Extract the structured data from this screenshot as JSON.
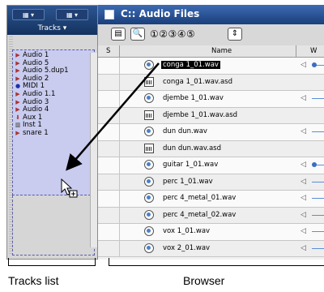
{
  "left_panel": {
    "toolbar_buttons": [
      "▾",
      "▾"
    ],
    "header_label": "Tracks",
    "tracks": [
      {
        "name": "Audio 1",
        "icon": "audio-track-icon",
        "color": "#a33"
      },
      {
        "name": "Audio 5",
        "icon": "audio-track-icon",
        "color": "#a33"
      },
      {
        "name": "Audio 5.dup1",
        "icon": "audio-track-icon",
        "color": "#a33"
      },
      {
        "name": "Audio 2",
        "icon": "audio-track-icon",
        "color": "#a33"
      },
      {
        "name": "MIDI 1",
        "icon": "midi-track-icon",
        "color": "#1d2fa8"
      },
      {
        "name": "Audio 1.1",
        "icon": "audio-track-icon",
        "color": "#a33"
      },
      {
        "name": "Audio 3",
        "icon": "audio-track-icon",
        "color": "#a33"
      },
      {
        "name": "Audio 4",
        "icon": "audio-track-icon",
        "color": "#a33"
      },
      {
        "name": "Aux 1",
        "icon": "aux-track-icon",
        "color": "#a33"
      },
      {
        "name": "Inst 1",
        "icon": "instrument-track-icon",
        "color": "#333"
      },
      {
        "name": "snare 1",
        "icon": "audio-track-icon",
        "color": "#a33"
      }
    ]
  },
  "browser": {
    "title": "C:: Audio Files",
    "toolbar": {
      "view_numbers": "①②③④⑤"
    },
    "columns": {
      "s": "S",
      "name": "Name",
      "waveform": "W"
    },
    "files": [
      {
        "name": "conga 1_01.wav",
        "type": "wav",
        "selected": true
      },
      {
        "name": "conga 1_01.wav.asd",
        "type": "asd",
        "selected": false
      },
      {
        "name": "djembe 1_01.wav",
        "type": "wav",
        "selected": false
      },
      {
        "name": "djembe 1_01.wav.asd",
        "type": "asd",
        "selected": false
      },
      {
        "name": "dun dun.wav",
        "type": "wav",
        "selected": false
      },
      {
        "name": "dun dun.wav.asd",
        "type": "asd",
        "selected": false
      },
      {
        "name": "guitar 1_01.wav",
        "type": "wav",
        "selected": false
      },
      {
        "name": "perc 1_01.wav",
        "type": "wav",
        "selected": false
      },
      {
        "name": "perc 4_metal_01.wav",
        "type": "wav",
        "selected": false
      },
      {
        "name": "perc 4_metal_02.wav",
        "type": "wav",
        "selected": false
      },
      {
        "name": "vox 1_01.wav",
        "type": "wav",
        "selected": false
      },
      {
        "name": "vox 2_01.wav",
        "type": "wav",
        "selected": false
      }
    ]
  },
  "captions": {
    "tracks_list": "Tracks list",
    "browser": "Browser"
  }
}
